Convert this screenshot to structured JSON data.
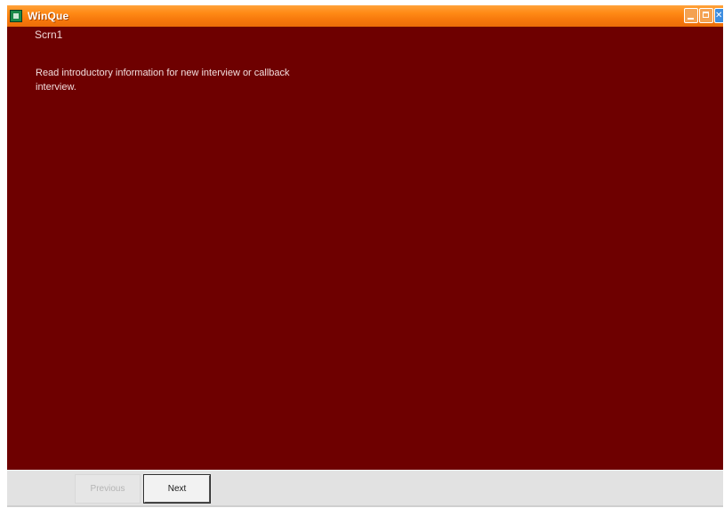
{
  "window": {
    "title": "WinQue",
    "icon": "app-icon",
    "controls": [
      "minimize-icon",
      "maximize-icon",
      "close-icon"
    ]
  },
  "screen": {
    "label": "Scrn1",
    "instruction": "Read introductory information for new interview or callback interview."
  },
  "footer": {
    "previous_label": "Previous",
    "next_label": "Next"
  },
  "colors": {
    "background": "#6e0000",
    "titlebar": "#f6770b",
    "footer": "#e2e2e2"
  }
}
